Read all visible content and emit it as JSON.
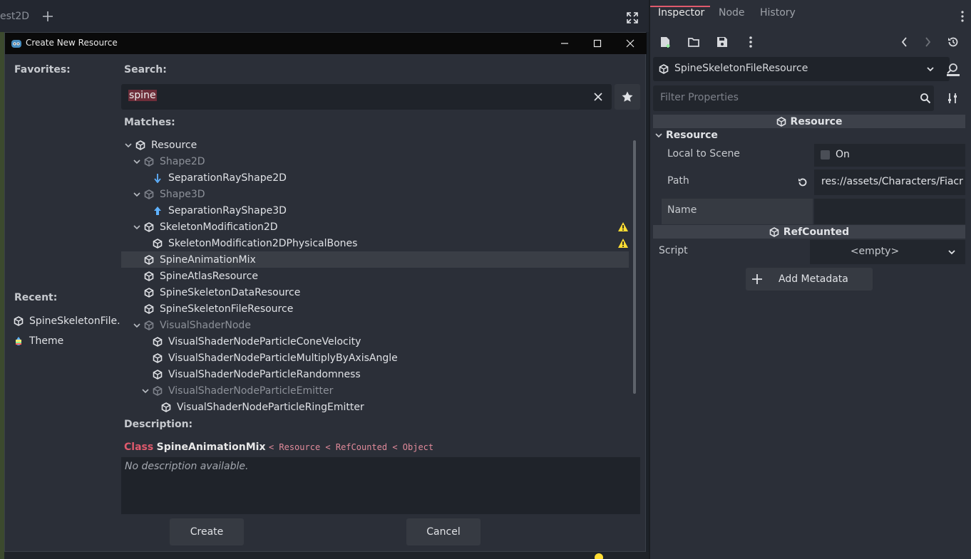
{
  "editor": {
    "scene_tab": "est2D"
  },
  "dialog": {
    "title": "Create New Resource",
    "favorites_label": "Favorites:",
    "recent_label": "Recent:",
    "recent": [
      {
        "label": "SpineSkeletonFile...",
        "icon": "resource-cube-icon"
      },
      {
        "label": "Theme",
        "icon": "theme-icon"
      }
    ],
    "search_label": "Search:",
    "search_value": "spine",
    "matches_label": "Matches:",
    "tree": [
      {
        "label": "Resource",
        "level": 0,
        "arrow": true,
        "icon": "cube",
        "dim": false
      },
      {
        "label": "Shape2D",
        "level": 1,
        "arrow": true,
        "icon": "cube",
        "dim": true
      },
      {
        "label": "SeparationRayShape2D",
        "level": 2,
        "arrow": false,
        "icon": "ray2d",
        "dim": false
      },
      {
        "label": "Shape3D",
        "level": 1,
        "arrow": true,
        "icon": "cube",
        "dim": true
      },
      {
        "label": "SeparationRayShape3D",
        "level": 2,
        "arrow": false,
        "icon": "ray3d",
        "dim": false
      },
      {
        "label": "SkeletonModification2D",
        "level": 1,
        "arrow": true,
        "icon": "cube",
        "dim": false,
        "warning": true
      },
      {
        "label": "SkeletonModification2DPhysicalBones",
        "level": 2,
        "arrow": false,
        "icon": "cube",
        "dim": false,
        "warning": true
      },
      {
        "label": "SpineAnimationMix",
        "level": 1,
        "arrow": false,
        "icon": "cube",
        "dim": false,
        "selected": true
      },
      {
        "label": "SpineAtlasResource",
        "level": 1,
        "arrow": false,
        "icon": "cube",
        "dim": false
      },
      {
        "label": "SpineSkeletonDataResource",
        "level": 1,
        "arrow": false,
        "icon": "cube",
        "dim": false
      },
      {
        "label": "SpineSkeletonFileResource",
        "level": 1,
        "arrow": false,
        "icon": "cube",
        "dim": false
      },
      {
        "label": "VisualShaderNode",
        "level": 1,
        "arrow": true,
        "icon": "cube",
        "dim": true
      },
      {
        "label": "VisualShaderNodeParticleConeVelocity",
        "level": 2,
        "arrow": false,
        "icon": "cube",
        "dim": false
      },
      {
        "label": "VisualShaderNodeParticleMultiplyByAxisAngle",
        "level": 2,
        "arrow": false,
        "icon": "cube",
        "dim": false
      },
      {
        "label": "VisualShaderNodeParticleRandomness",
        "level": 2,
        "arrow": false,
        "icon": "cube",
        "dim": false
      },
      {
        "label": "VisualShaderNodeParticleEmitter",
        "level": 2,
        "arrow": true,
        "icon": "cube",
        "dim": true
      },
      {
        "label": "VisualShaderNodeParticleRingEmitter",
        "level": 3,
        "arrow": false,
        "icon": "cube",
        "dim": false
      }
    ],
    "description_label": "Description:",
    "desc_class_word": "Class",
    "desc_class_name": "SpineAnimationMix",
    "desc_inherit_chain": "< Resource < RefCounted < Object",
    "desc_text": "No description available.",
    "create_label": "Create",
    "cancel_label": "Cancel"
  },
  "inspector": {
    "tabs": {
      "inspector": "Inspector",
      "node": "Node",
      "history": "History"
    },
    "resource_selector": "SpineSkeletonFileResource",
    "filter_placeholder": "Filter Properties",
    "section_resource": "Resource",
    "group_resource": "Resource",
    "local_to_scene_label": "Local to Scene",
    "local_to_scene_value": "On",
    "path_label": "Path",
    "path_value": "res://assets/Characters/Fiacr",
    "name_label": "Name",
    "section_refcounted": "RefCounted",
    "script_label": "Script",
    "script_value": "<empty>",
    "add_metadata_label": "Add Metadata"
  },
  "colors": {
    "accent": "#e05a6d",
    "warning": "#ffdd33",
    "panel": "#2b2f38",
    "field": "#1f232a"
  }
}
